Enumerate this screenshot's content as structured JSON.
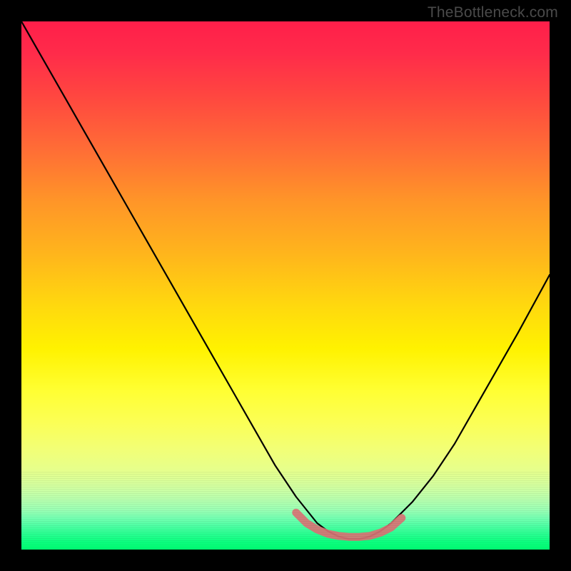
{
  "watermark": "TheBottleneck.com",
  "chart_data": {
    "type": "line",
    "title": "",
    "xlabel": "",
    "ylabel": "",
    "xlim": [
      0,
      100
    ],
    "ylim": [
      0,
      100
    ],
    "series": [
      {
        "name": "bottleneck-curve",
        "x": [
          0,
          4,
          8,
          12,
          16,
          20,
          24,
          28,
          32,
          36,
          40,
          44,
          48,
          52,
          56,
          58,
          60,
          62,
          64,
          66,
          68,
          70,
          74,
          78,
          82,
          86,
          90,
          94,
          100
        ],
        "values": [
          100,
          93,
          86,
          79,
          72,
          65,
          58,
          51,
          44,
          37,
          30,
          23,
          16,
          10,
          5,
          3.5,
          2.5,
          2,
          2,
          2.5,
          3.5,
          5,
          9,
          14,
          20,
          27,
          34,
          41,
          52
        ]
      },
      {
        "name": "optimal-band",
        "x": [
          52,
          54,
          56,
          58,
          60,
          62,
          64,
          66,
          68,
          70,
          72
        ],
        "values": [
          7,
          5,
          3.8,
          3,
          2.6,
          2.4,
          2.4,
          2.6,
          3.2,
          4.2,
          6
        ]
      }
    ],
    "background_gradient": {
      "top": "#ff1f4a",
      "mid": "#fff200",
      "bottom": "#00ff72"
    },
    "highlight_color": "#db7375"
  }
}
